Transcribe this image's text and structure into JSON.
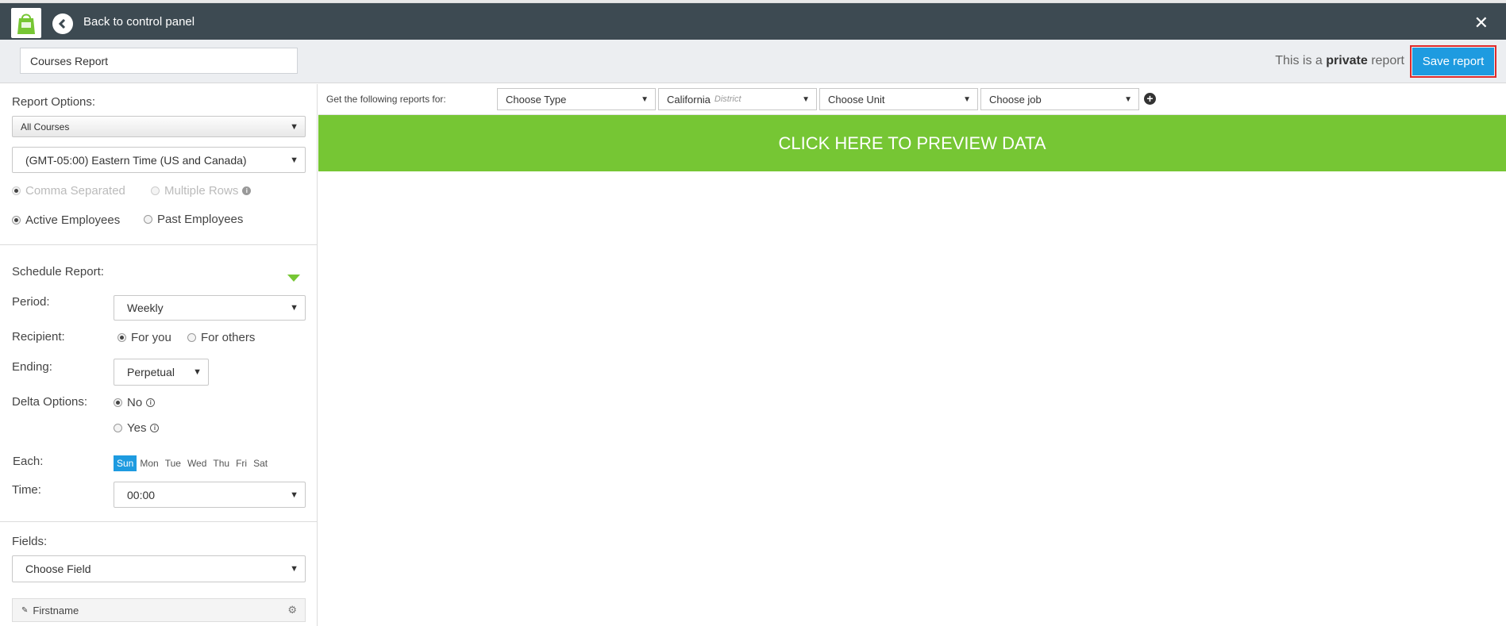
{
  "topbar": {
    "back_label": "Back to control panel",
    "close_icon": "close-icon",
    "back_icon": "chevron-left-icon",
    "logo_icon": "shopping-bag-icon"
  },
  "header": {
    "report_name": "Courses Report",
    "private_prefix": "This is a",
    "private_word": "private",
    "private_suffix": "report",
    "save_label": "Save report"
  },
  "report_options": {
    "title": "Report Options:",
    "courses_select": "All Courses",
    "timezone_select": "(GMT-05:00) Eastern Time (US and Canada)",
    "format_comma": "Comma Separated",
    "format_rows": "Multiple Rows",
    "employees_active": "Active Employees",
    "employees_past": "Past Employees"
  },
  "schedule": {
    "title": "Schedule Report:",
    "period_label": "Period:",
    "period_value": "Weekly",
    "recipient_label": "Recipient:",
    "recipient_you": "For you",
    "recipient_others": "For others",
    "ending_label": "Ending:",
    "ending_value": "Perpetual",
    "delta_label": "Delta Options:",
    "delta_no": "No",
    "delta_yes": "Yes",
    "each_label": "Each:",
    "days": [
      "Sun",
      "Mon",
      "Tue",
      "Wed",
      "Thu",
      "Fri",
      "Sat"
    ],
    "active_day": "Sun",
    "time_label": "Time:",
    "time_value": "00:00"
  },
  "fields": {
    "title": "Fields:",
    "choose_field": "Choose Field",
    "items": [
      "Firstname"
    ]
  },
  "filters": {
    "label": "Get the following reports for:",
    "type": "Choose Type",
    "district_name": "California",
    "district_tag": "District",
    "unit": "Choose Unit",
    "job": "Choose job"
  },
  "preview_label": "CLICK HERE TO PREVIEW DATA",
  "colors": {
    "topbar": "#3d4a52",
    "accent_blue": "#1e9be0",
    "accent_green": "#76c634",
    "highlight_red": "#e02b2b"
  }
}
